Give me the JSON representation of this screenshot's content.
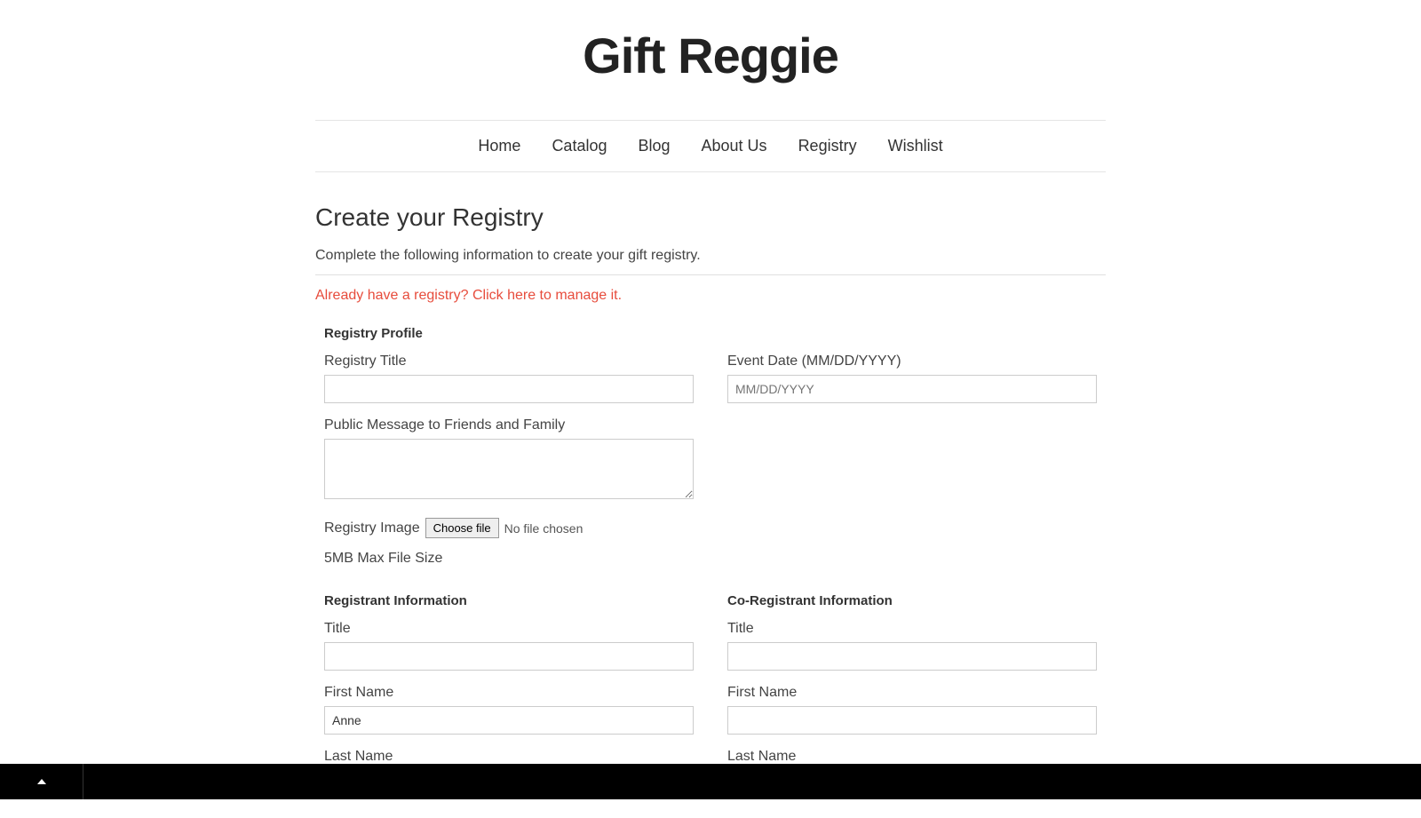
{
  "site": {
    "title": "Gift Reggie"
  },
  "nav": {
    "items": [
      {
        "label": "Home"
      },
      {
        "label": "Catalog"
      },
      {
        "label": "Blog"
      },
      {
        "label": "About Us"
      },
      {
        "label": "Registry"
      },
      {
        "label": "Wishlist"
      }
    ]
  },
  "page": {
    "heading": "Create your Registry",
    "subtitle": "Complete the following information to create your gift registry.",
    "manage_link": "Already have a registry? Click here to manage it."
  },
  "sections": {
    "profile": "Registry Profile",
    "registrant": "Registrant Information",
    "coregistrant": "Co-Registrant Information"
  },
  "fields": {
    "registry_title_label": "Registry Title",
    "registry_title_value": "",
    "event_date_label": "Event Date (MM/DD/YYYY)",
    "event_date_placeholder": "MM/DD/YYYY",
    "event_date_value": "",
    "public_message_label": "Public Message to Friends and Family",
    "public_message_value": "",
    "registry_image_label": "Registry Image",
    "choose_file_button": "Choose file",
    "no_file_text": "No file chosen",
    "file_note": "5MB Max File Size",
    "title_label": "Title",
    "first_name_label": "First Name",
    "last_name_label": "Last Name",
    "registrant_title_value": "",
    "registrant_first_name_value": "Anne",
    "coregistrant_title_value": "",
    "coregistrant_first_name_value": ""
  }
}
